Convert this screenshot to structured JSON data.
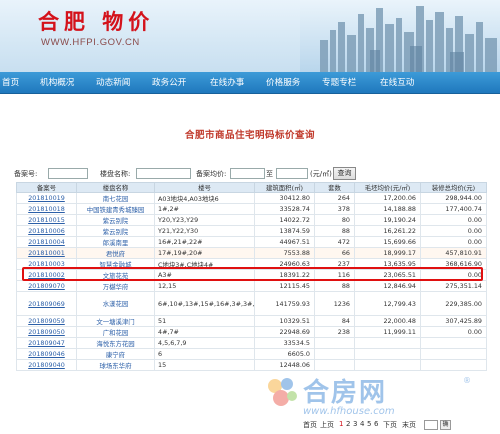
{
  "header": {
    "title": "合肥 物价",
    "url": "WWW.HFPI.GOV.CN"
  },
  "nav": [
    "首页",
    "机构概况",
    "动态新闻",
    "政务公开",
    "在线办事",
    "价格服务",
    "专题专栏",
    "在线互动"
  ],
  "page_title": "合肥市商品住宅明码标价查询",
  "search": {
    "record_label": "备案号:",
    "name_label": "楼盘名称:",
    "price_label": "备案均价:",
    "to_label": "至",
    "unit": "(元/㎡)",
    "button": "查询"
  },
  "table": {
    "headers": [
      "备案号",
      "楼盘名称",
      "楼号",
      "建筑面积(㎡)",
      "套数",
      "毛坯均价(元/㎡)",
      "装修总均价(元)"
    ],
    "rows": [
      [
        "201810019",
        "南七花园",
        "A03地块4,A03地块6",
        "30412.80",
        "264",
        "17,200.06",
        "298,944.00"
      ],
      [
        "201810018",
        "中国铁建青秀城臻园",
        "1#,2#",
        "33528.74",
        "378",
        "14,188.88",
        "177,400.74"
      ],
      [
        "201810015",
        "紫云别院",
        "Y20,Y23,Y29",
        "14022.72",
        "80",
        "19,190.24",
        "0.00"
      ],
      [
        "201810006",
        "紫云别院",
        "Y21,Y22,Y30",
        "13874.59",
        "88",
        "16,261.22",
        "0.00"
      ],
      [
        "201810004",
        "郎溪南里",
        "16#,21#,22#",
        "44967.51",
        "472",
        "15,699.66",
        "0.00"
      ],
      [
        "201810001",
        "君悦府",
        "17#,19#,20#",
        "7553.88",
        "66",
        "18,999.17",
        "457,810.91"
      ],
      [
        "201810003",
        "智慧金融城",
        "C地块3#,C地块4#",
        "24960.63",
        "237",
        "13,635.95",
        "368,616.90"
      ],
      [
        "201810002",
        "文旅花苑",
        "A3#",
        "18391.22",
        "116",
        "23,065.51",
        "0.00"
      ],
      [
        "201809070",
        "万樾华府",
        "12,15",
        "12115.45",
        "88",
        "12,846.94",
        "275,351.14"
      ],
      [
        "201809069",
        "水漾花园",
        "6#,10#,13#,15#,16#,3#,3#,11#",
        "141759.93",
        "1236",
        "12,799.43",
        "229,385.00"
      ],
      [
        "201809059",
        "文一塘溪津门",
        "51",
        "10329.51",
        "84",
        "22,000.48",
        "307,425.89"
      ],
      [
        "201809050",
        "广和花园",
        "4#,7#",
        "22948.69",
        "238",
        "11,999.11",
        "0.00"
      ],
      [
        "201809047",
        "海悦东方花园",
        "4,5,6,7,9",
        "33534.5",
        "",
        "",
        ""
      ],
      [
        "201809046",
        "康宁府",
        "6",
        "6605.0",
        "",
        "",
        ""
      ],
      [
        "201809040",
        "球场东华府",
        "15",
        "12448.06",
        "",
        "",
        ""
      ]
    ]
  },
  "pager": {
    "first": "首页",
    "prev": "上页",
    "pages": [
      "1",
      "2",
      "3",
      "4",
      "5",
      "6"
    ],
    "current": "1",
    "next": "下页",
    "last": "末页",
    "go": "确"
  },
  "watermark": {
    "text": "合房网",
    "url": "www.hfhouse.com",
    "reg": "®"
  },
  "colors": {
    "brand_red": "#d4121b",
    "nav_blue": "#1f78bd",
    "highlight": "#e01010"
  }
}
